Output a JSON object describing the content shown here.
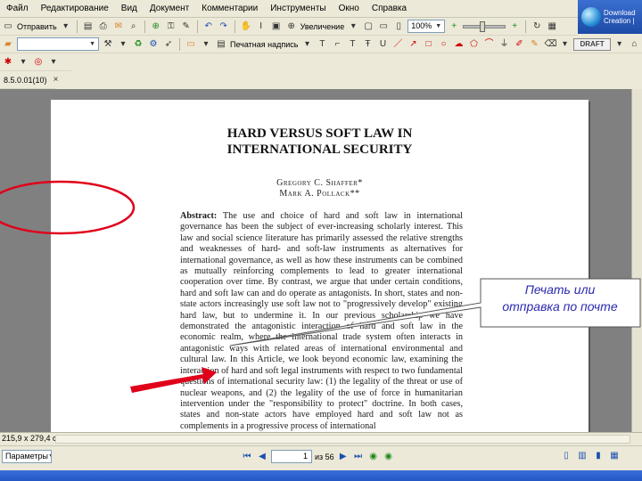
{
  "menubar": {
    "items": [
      "Файл",
      "Редактирование",
      "Вид",
      "Документ",
      "Комментарии",
      "Инструменты",
      "Окно",
      "Справка"
    ]
  },
  "logo": {
    "line1": "Download",
    "line2": "Creation |"
  },
  "toolbar1": {
    "save_label": "Отправить",
    "zoom_mode": "Увеличение",
    "zoom_value": "100%"
  },
  "toolbar2": {
    "comment_label": "Печатная надпись",
    "draft_label": "DRAFT"
  },
  "tab": {
    "label": "8.5.0.01(10)"
  },
  "document": {
    "title_line1": "HARD VERSUS SOFT LAW IN",
    "title_line2": "INTERNATIONAL SECURITY",
    "author1": "Gregory C. Shaffer*",
    "author2": "Mark A. Pollack**",
    "abstract_label": "Abstract:",
    "abstract_text": "The use and choice of hard and soft law in international governance has been the subject of ever-increasing scholarly interest. This law and social science literature has primarily assessed the relative strengths and weaknesses of hard- and soft-law instruments as alternatives for international governance, as well as how these instruments can be combined as mutually reinforcing complements to lead to greater international cooperation over time. By contrast, we argue that under certain conditions, hard and soft law can and do operate as antagonists. In short, states and non-state actors increasingly use soft law not to \"progressively develop\" existing hard law, but to undermine it. In our previous scholarship we have demonstrated the antagonistic interaction of hard and soft law in the economic realm, where the international trade system often interacts in antagonistic ways with related areas of international environmental and cultural law. In this Article, we look beyond economic law, examining the interaction of hard and soft legal instruments with respect to two fundamental questions of international security law: (1) the legality of the threat or use of nuclear weapons, and (2) the legality of the use of force in humanitarian intervention under the \"responsibility to protect\" doctrine. In both cases, states and non-state actors have employed hard and soft law not as complements in a progressive process of international"
  },
  "callout": {
    "line1": "Печать или",
    "line2": "отправка по почте"
  },
  "statusbar": {
    "page_size": "215,9 x 279,4 см"
  },
  "navbar": {
    "view_label": "Параметры",
    "current_page": "1",
    "page_count": "из 56"
  },
  "colors": {
    "annotation_red": "#e0001a",
    "callout_blue": "#2a2ab0"
  }
}
